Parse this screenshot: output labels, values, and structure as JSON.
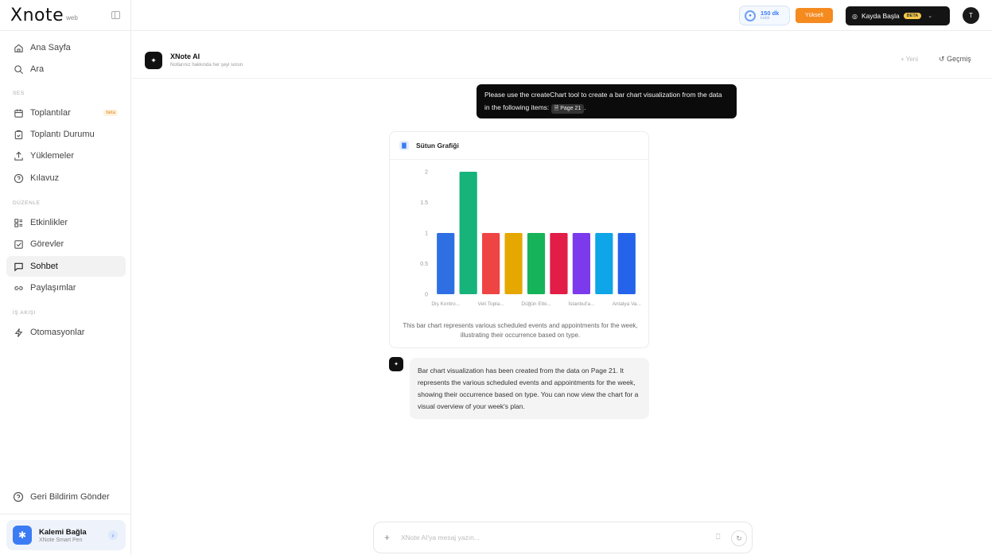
{
  "app": {
    "logo": "Xnote",
    "logo_suffix": "web"
  },
  "sidebar": {
    "items_top": [
      {
        "label": "Ana Sayfa",
        "icon": "home-icon"
      },
      {
        "label": "Ara",
        "icon": "search-icon"
      }
    ],
    "section_ses": "SES",
    "items_ses": [
      {
        "label": "Toplantılar",
        "icon": "calendar-icon",
        "badge": "beta"
      },
      {
        "label": "Toplantı Durumu",
        "icon": "clipboard-icon"
      },
      {
        "label": "Yüklemeler",
        "icon": "upload-icon"
      },
      {
        "label": "Kılavuz",
        "icon": "help-icon"
      }
    ],
    "section_duzenle": "DÜZENLE",
    "items_duzenle": [
      {
        "label": "Etkinlikler",
        "icon": "list-icon"
      },
      {
        "label": "Görevler",
        "icon": "checkbox-icon"
      },
      {
        "label": "Sohbet",
        "icon": "chat-icon",
        "active": true
      },
      {
        "label": "Paylaşımlar",
        "icon": "link-icon"
      }
    ],
    "section_is_akisi": "İŞ AKIŞI",
    "items_is_akisi": [
      {
        "label": "Otomasyonlar",
        "icon": "automation-icon"
      }
    ],
    "feedback": "Geri Bildirim Gönder",
    "pen": {
      "title": "Kalemi Bağla",
      "subtitle": "XNote Smart Pen"
    }
  },
  "topbar": {
    "minutes_value": "150 dk",
    "minutes_label": "kaldı",
    "upgrade": "Yükselt",
    "record": "Kayda Başla",
    "record_badge": "BETA",
    "avatar": "T"
  },
  "chat": {
    "header_title": "XNote AI",
    "header_subtitle": "Notlarınız hakkında her şeyi sorun",
    "new_label": "+ Yeni",
    "history_label": "Geçmiş",
    "user_message": "Please use the createChart tool to create a bar chart visualization from the data in the following items:",
    "user_message_chip": "Page 21",
    "user_message_end": ".",
    "chart_card_title": "Sütun Grafiği",
    "chart_description": "This bar chart represents various scheduled events and appointments for the week, illustrating their occurrence based on type.",
    "ai_response": "Bar chart visualization has been created from the data on Page 21. It represents the various scheduled events and appointments for the week, showing their occurrence based on type. You can now view the chart for a visual overview of your week's plan.",
    "input_placeholder": "XNote AI'ya mesaj yazın..."
  },
  "chart_data": {
    "type": "bar",
    "categories": [
      "Diş Kontro...",
      "",
      "Veli Topla...",
      "",
      "Düğün Etki...",
      "",
      "İstanbul'a...",
      "",
      "Antalya Va..."
    ],
    "values": [
      1,
      2,
      1,
      1,
      1,
      1,
      1,
      1,
      1
    ],
    "colors": [
      "#2f6fe4",
      "#16b37a",
      "#ef4444",
      "#e6a800",
      "#16b35a",
      "#e11d48",
      "#7c3aed",
      "#0ea5e9",
      "#2563eb"
    ],
    "yticks": [
      "0",
      "0.5",
      "1",
      "1.5",
      "2"
    ],
    "ylim": [
      0,
      2
    ],
    "grid": false
  }
}
